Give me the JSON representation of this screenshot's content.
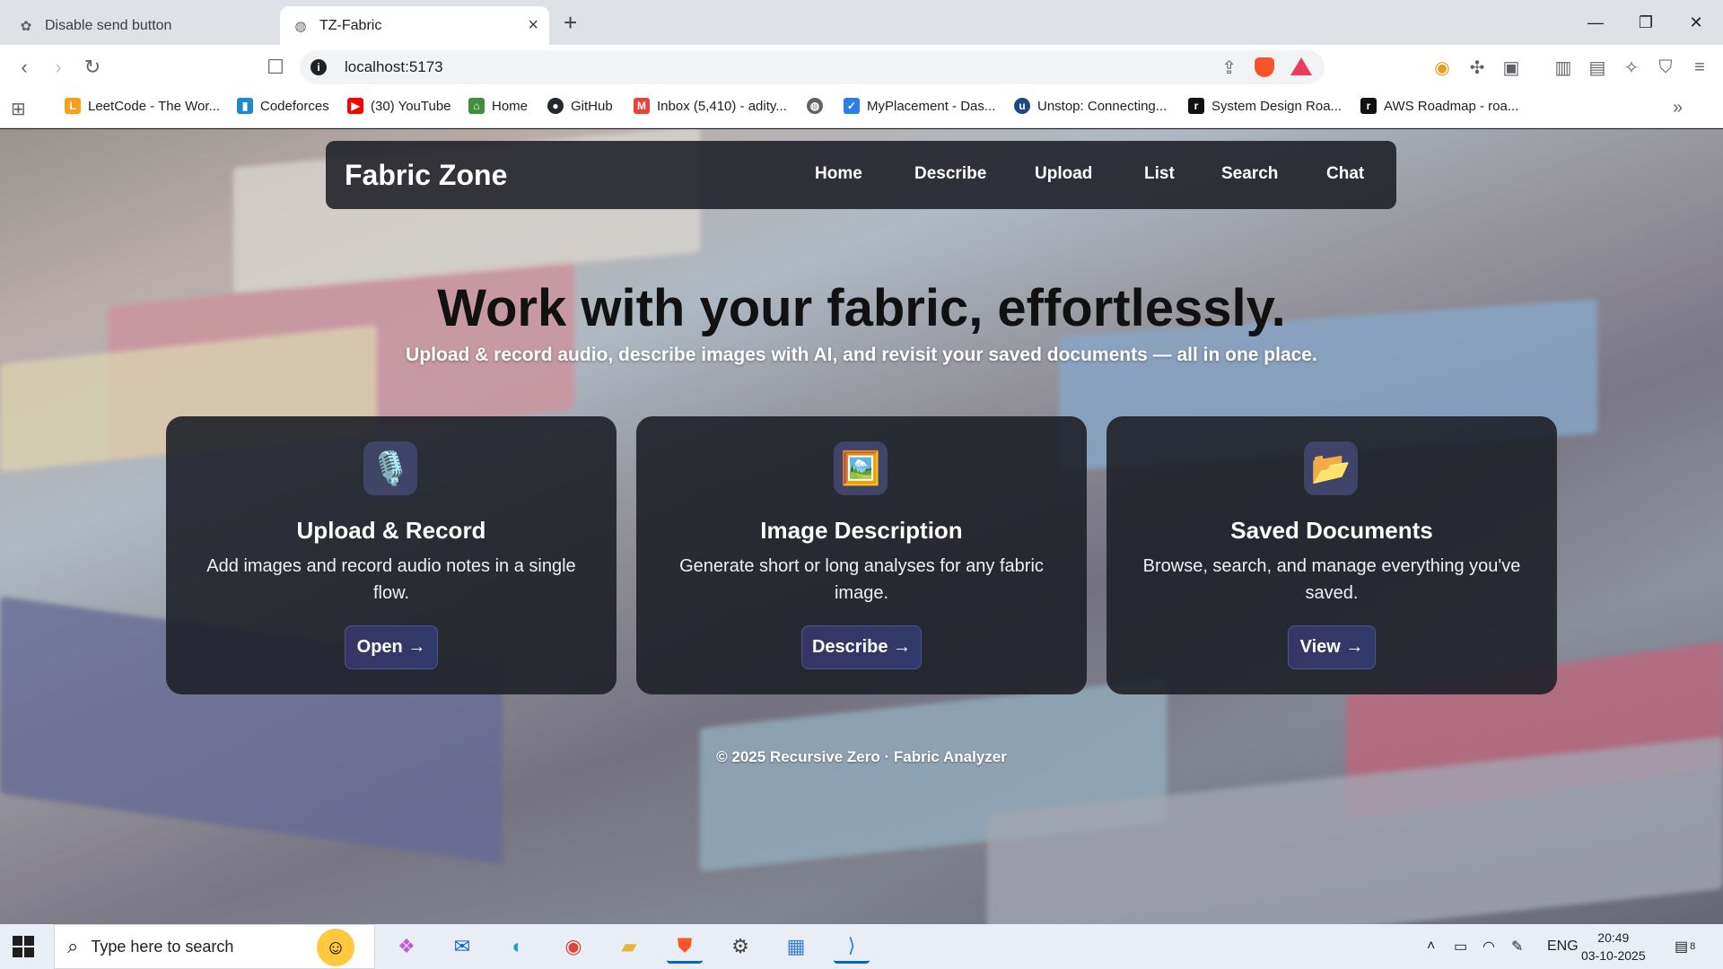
{
  "browser": {
    "tabs": [
      {
        "title": "Disable send button",
        "icon": "openai-icon"
      },
      {
        "title": "TZ-Fabric",
        "icon": "globe-icon"
      }
    ],
    "url": "localhost:5173",
    "bookmarks": [
      {
        "label": "LeetCode - The Wor...",
        "icon": "leetcode-icon",
        "color": "#f89f1b"
      },
      {
        "label": "Codeforces",
        "icon": "codeforces-icon",
        "color": "#1f8acb"
      },
      {
        "label": "(30) YouTube",
        "icon": "youtube-icon",
        "color": "#ff0000"
      },
      {
        "label": "Home",
        "icon": "home-icon",
        "color": "#3f8f3f"
      },
      {
        "label": "GitHub",
        "icon": "github-icon",
        "color": "#24292f"
      },
      {
        "label": "Inbox (5,410) - adity...",
        "icon": "gmail-icon",
        "color": "#ea4335"
      },
      {
        "label": "",
        "icon": "globe-icon",
        "color": "#5f6368"
      },
      {
        "label": "MyPlacement - Das...",
        "icon": "myplacement-icon",
        "color": "#2b7de9"
      },
      {
        "label": "Unstop: Connecting...",
        "icon": "unstop-icon",
        "color": "#1c4980"
      },
      {
        "label": "System Design Roa...",
        "icon": "roadmap-icon",
        "color": "#111111"
      },
      {
        "label": "AWS Roadmap - roa...",
        "icon": "roadmap-icon",
        "color": "#111111"
      }
    ]
  },
  "site": {
    "brand": "Fabric Zone",
    "nav": [
      "Home",
      "Describe",
      "Upload",
      "List",
      "Search",
      "Chat"
    ],
    "hero_title": "Work with your fabric, effortlessly.",
    "hero_subtitle": "Upload & record audio, describe images with AI, and revisit your saved documents — all in one place.",
    "cards": [
      {
        "icon": "microphone-icon",
        "glyph": "🎙️",
        "title": "Upload & Record",
        "description": "Add images and record audio notes in a single flow.",
        "button": "Open →"
      },
      {
        "icon": "picture-icon",
        "glyph": "🖼️",
        "title": "Image Description",
        "description": "Generate short or long analyses for any fabric image.",
        "button": "Describe →"
      },
      {
        "icon": "folder-icon",
        "glyph": "📂",
        "title": "Saved Documents",
        "description": "Browse, search, and manage everything you've saved.",
        "button": "View →"
      }
    ],
    "footer": "© 2025 Recursive Zero · Fabric Analyzer"
  },
  "taskbar": {
    "search_placeholder": "Type here to search",
    "language": "ENG",
    "time": "20:49",
    "date": "03-10-2025",
    "notification_count": "8",
    "accent": "#0067c0"
  }
}
